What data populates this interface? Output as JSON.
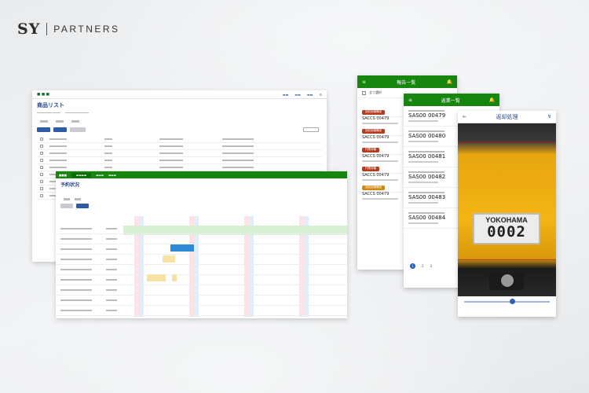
{
  "logo": {
    "mark": "SY",
    "text": "PARTNERS"
  },
  "product_window": {
    "title": "商品リスト",
    "rows": 9
  },
  "reservation_window": {
    "title": "予約状況"
  },
  "phone_list": {
    "title": "報告一覧",
    "select_all": "全て選択",
    "items": [
      {
        "tag": "回収依頼確認",
        "tag_color": "#b33b1c",
        "code": "SACCS 00479"
      },
      {
        "tag": "回収依頼確認",
        "tag_color": "#b33b1c",
        "code": "SACCS 00479"
      },
      {
        "tag": "作業待機",
        "tag_color": "#b33b1c",
        "code": "SACCS 00479"
      },
      {
        "tag": "作業待機",
        "tag_color": "#b33b1c",
        "code": "SACCS 00479"
      },
      {
        "tag": "回収依頼確認",
        "tag_color": "#d08a10",
        "code": "SACCS 00479"
      }
    ]
  },
  "phone_queue": {
    "title": "返業一覧",
    "items": [
      {
        "code": "SAS00 00479"
      },
      {
        "code": "SAS00 00480"
      },
      {
        "code": "SAS00 00481"
      },
      {
        "code": "SAS00 00482"
      },
      {
        "code": "SAS00 00483"
      },
      {
        "code": "SAS00 00484"
      }
    ],
    "pagination": [
      "1",
      "2",
      "3"
    ]
  },
  "phone_camera": {
    "title": "返却処理",
    "plate_city": "YOKOHAMA",
    "plate_number": "0002"
  }
}
